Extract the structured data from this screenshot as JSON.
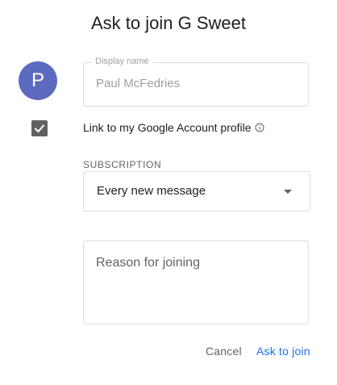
{
  "dialog": {
    "title": "Ask to join G Sweet",
    "avatar_initial": "P",
    "display_name": {
      "label": "Display name",
      "value": "Paul McFedries"
    },
    "link_account": {
      "checked": true,
      "label": "Link to my Google Account profile",
      "info_icon": "info-icon"
    },
    "subscription": {
      "label": "SUBSCRIPTION",
      "selected": "Every new message"
    },
    "reason": {
      "placeholder": "Reason for joining"
    },
    "buttons": {
      "cancel": "Cancel",
      "join": "Ask to join"
    }
  },
  "colors": {
    "avatar": "#5c6bc0",
    "primary": "#1a73e8",
    "checkbox": "#616161"
  }
}
